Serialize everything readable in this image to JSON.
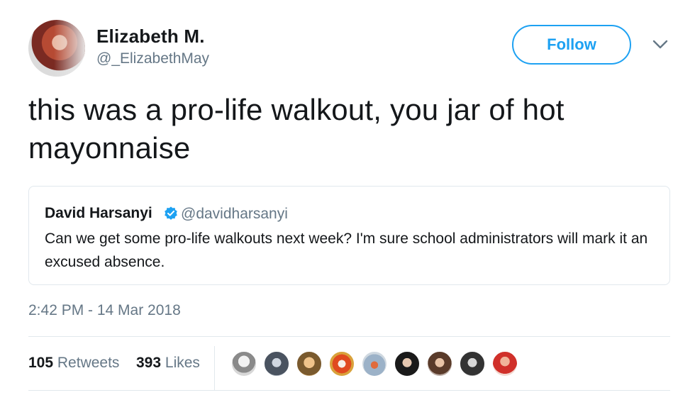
{
  "author": {
    "name": "Elizabeth M.",
    "handle": "@_ElizabethMay"
  },
  "follow_button": {
    "label": "Follow"
  },
  "tweet": {
    "text": "this was a pro-life walkout, you jar of hot mayonnaise",
    "timestamp": "2:42 PM - 14 Mar 2018"
  },
  "quoted_tweet": {
    "name": "David Harsanyi",
    "handle": "@davidharsanyi",
    "verified": true,
    "text": "Can we get some pro-life walkouts next week? I'm sure school administrators will mark it an excused absence."
  },
  "stats": {
    "retweets_count": "105",
    "retweets_label": "Retweets",
    "likes_count": "393",
    "likes_label": "Likes"
  },
  "colors": {
    "accent": "#1da1f2",
    "secondary_text": "#657786",
    "border": "#e1e8ed"
  }
}
